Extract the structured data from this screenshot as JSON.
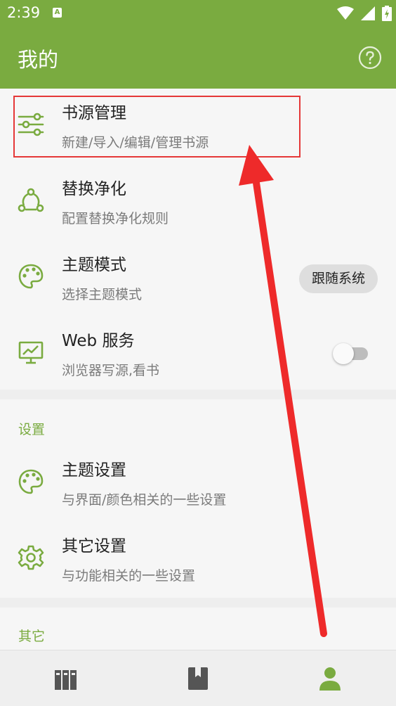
{
  "status_bar": {
    "time": "2:39",
    "a_badge": "A"
  },
  "app_bar": {
    "title": "我的"
  },
  "items_main": [
    {
      "title": "书源管理",
      "subtitle": "新建/导入/编辑/管理书源"
    },
    {
      "title": "替换净化",
      "subtitle": "配置替换净化规则"
    },
    {
      "title": "主题模式",
      "subtitle": "选择主题模式",
      "chip": "跟随系统"
    },
    {
      "title": "Web 服务",
      "subtitle": "浏览器写源,看书",
      "switch_on": false
    }
  ],
  "settings": {
    "label": "设置",
    "items": [
      {
        "title": "主题设置",
        "subtitle": "与界面/颜色相关的一些设置"
      },
      {
        "title": "其它设置",
        "subtitle": "与功能相关的一些设置"
      }
    ]
  },
  "other": {
    "label": "其它"
  },
  "colors": {
    "accent": "#7aab40",
    "annotation": "#e53838"
  },
  "icons": {
    "help": "help-circle-icon",
    "source": "sliders-icon",
    "replace": "share-nodes-icon",
    "theme_mode": "palette-icon",
    "web": "monitor-chart-icon",
    "theme_settings": "palette-icon",
    "other_settings": "gear-icon",
    "nav": [
      "bookshelf-icon",
      "book-icon",
      "person-icon"
    ]
  }
}
